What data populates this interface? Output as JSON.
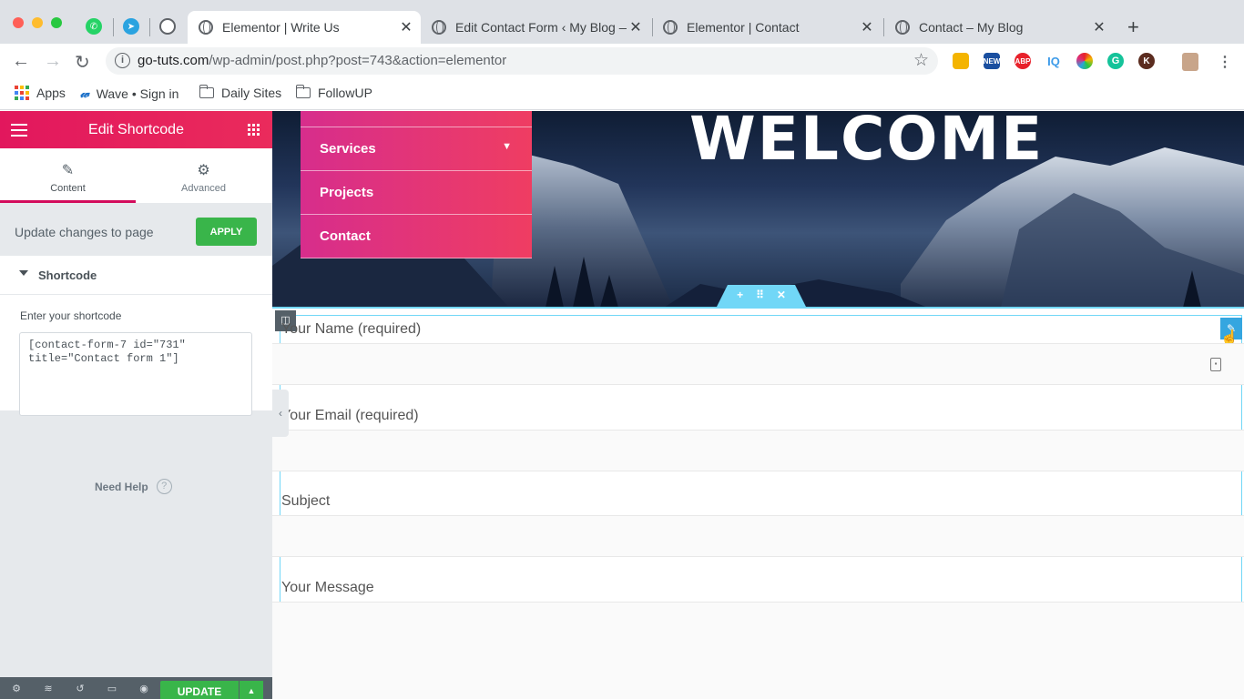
{
  "browser": {
    "tabs": [
      {
        "title": "Elementor | Write Us",
        "active": true
      },
      {
        "title": "Edit Contact Form ‹ My Blog —",
        "active": false
      },
      {
        "title": "Elementor | Contact",
        "active": false
      },
      {
        "title": "Contact – My Blog",
        "active": false
      }
    ],
    "url_host": "go-tuts.com",
    "url_path": "/wp-admin/post.php?post=743&action=elementor",
    "bookmarks": [
      {
        "label": "Apps",
        "icon": "apps-grid-icon"
      },
      {
        "label": "Wave • Sign in",
        "icon": "wave-icon"
      },
      {
        "label": "Daily Sites",
        "icon": "folder-icon"
      },
      {
        "label": "FollowUP",
        "icon": "folder-icon"
      }
    ],
    "extensions": [
      {
        "name": "notes-extension-icon",
        "color": "#f4b400"
      },
      {
        "name": "news-extension-icon",
        "color": "#1a4fa0",
        "label": "NEW"
      },
      {
        "name": "adblock-extension-icon",
        "color": "#e8212b",
        "label": "ABP"
      },
      {
        "name": "iq-extension-icon",
        "color": "#3d9be9",
        "label": "IQ"
      },
      {
        "name": "colorful-extension-icon",
        "color": "#d9307e"
      },
      {
        "name": "grammarly-extension-icon",
        "color": "#15c39a",
        "label": "G"
      },
      {
        "name": "k-extension-icon",
        "color": "#5b2c1f",
        "label": "K"
      }
    ]
  },
  "panel": {
    "header_title": "Edit Shortcode",
    "tabs": [
      {
        "label": "Content",
        "icon": "pencil-icon",
        "active": true
      },
      {
        "label": "Advanced",
        "icon": "gear-icon",
        "active": false
      }
    ],
    "update_text": "Update changes to page",
    "apply_label": "APPLY",
    "section_title": "Shortcode",
    "field_label": "Enter your shortcode",
    "shortcode_value": "[contact-form-7 id=\"731\" title=\"Contact form 1\"]",
    "help_label": "Need Help",
    "update_label": "UPDATE"
  },
  "canvas": {
    "welcome": "WELCOME",
    "menu_items": [
      "Services",
      "Projects",
      "Contact"
    ],
    "form_labels": [
      "Your Name (required)",
      "Your Email (required)",
      "Subject",
      "Your Message"
    ]
  },
  "colors": {
    "elementor_pink": "#e2175d",
    "apply_green": "#39b54a",
    "selection_blue": "#71d7f7"
  }
}
